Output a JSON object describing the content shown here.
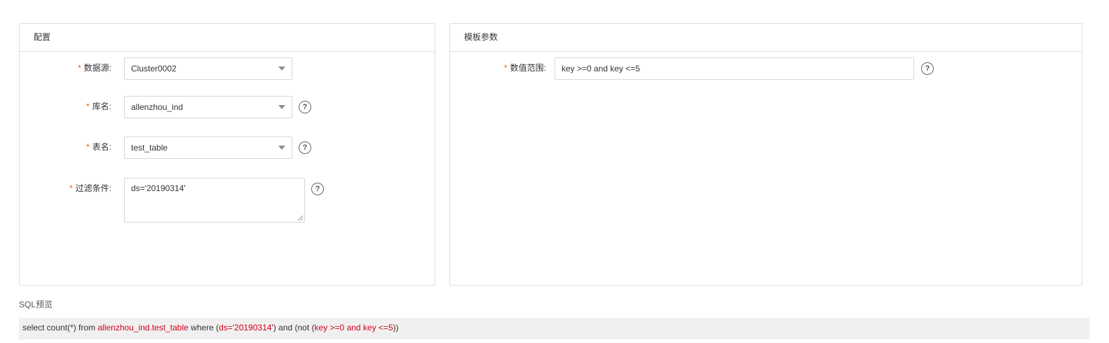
{
  "config_panel": {
    "title": "配置",
    "fields": {
      "datasource": {
        "required_mark": "*",
        "label": "数据源:",
        "value": "Cluster0002"
      },
      "database": {
        "required_mark": "*",
        "label": "库名:",
        "value": "allenzhou_ind"
      },
      "table": {
        "required_mark": "*",
        "label": "表名:",
        "value": "test_table"
      },
      "filter": {
        "required_mark": "*",
        "label": "过滤条件:",
        "value": "ds='20190314'"
      }
    },
    "help_glyph": "?"
  },
  "template_panel": {
    "title": "模板参数",
    "fields": {
      "value_range": {
        "required_mark": "*",
        "label": "数值范围:",
        "value": "key >=0 and key <=5"
      }
    },
    "help_glyph": "?"
  },
  "sql_preview": {
    "title": "SQL预览",
    "parts": {
      "p1": "select count(*) from ",
      "p2": "allenzhou_ind.test_table",
      "p3": " where (",
      "p4": "ds='20190314'",
      "p5": ") and (not (",
      "p6": "key >=0 and key <=5",
      "p7": "))"
    }
  },
  "colors": {
    "required": "#ff5a00",
    "highlight": "#d0021b",
    "border": "#dcdfe6",
    "sql_bg": "#f0f0f0"
  },
  "icons": {
    "dropdown": "chevron-down-icon",
    "help": "help-circle-icon",
    "resize": "resize-grip-icon"
  }
}
